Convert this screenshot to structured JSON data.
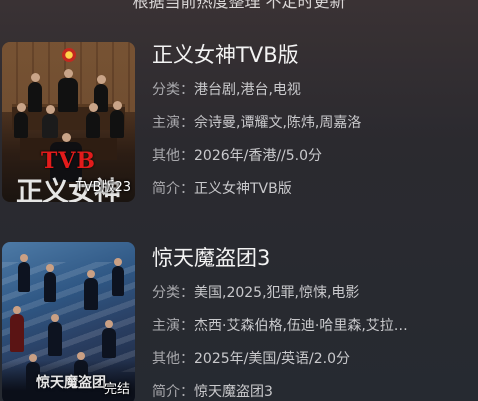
{
  "header": {
    "note": "根据当前热度整理 不定时更新"
  },
  "items": [
    {
      "title": "正义女神TVB版",
      "poster": {
        "brand": "TVB",
        "poster_title": "正义女神",
        "overlay": "TVB版23"
      },
      "fields": [
        {
          "label": "分类：",
          "value": "港台剧,港台,电视"
        },
        {
          "label": "主演：",
          "value": "佘诗曼,谭耀文,陈炜,周嘉洛"
        },
        {
          "label": "其他：",
          "value": "2026年/香港//5.0分"
        },
        {
          "label": "简介：",
          "value": "正义女神TVB版"
        }
      ]
    },
    {
      "title": "惊天魔盗团3",
      "poster": {
        "poster_title": "惊天魔盗团",
        "overlay": "完结"
      },
      "fields": [
        {
          "label": "分类：",
          "value": "美国,2025,犯罪,惊悚,电影"
        },
        {
          "label": "主演：",
          "value": "杰西·艾森伯格,伍迪·哈里森,艾拉…"
        },
        {
          "label": "其他：",
          "value": "2025年/美国/英语/2.0分"
        },
        {
          "label": "简介：",
          "value": "惊天魔盗团3"
        }
      ]
    }
  ]
}
